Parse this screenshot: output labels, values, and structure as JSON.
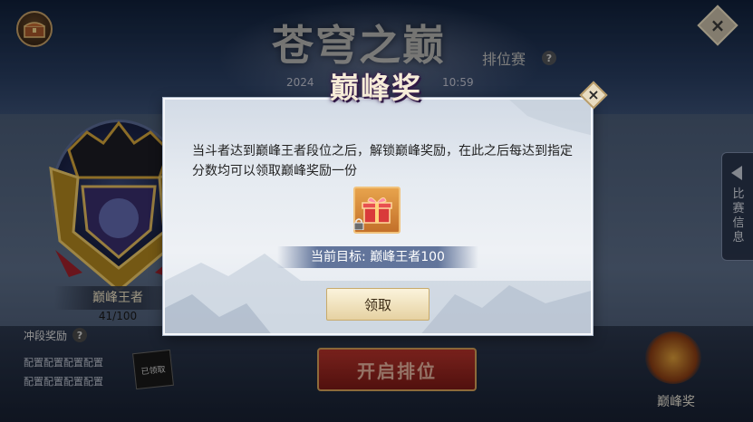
{
  "background": {
    "title": "苍穹之巅",
    "subtitle": "排位赛",
    "help_glyph": "?",
    "date_start": "2024",
    "date_end": "10:59",
    "close_glyph": "×",
    "chest_icon": "treasure-chest-icon"
  },
  "rank": {
    "name": "巅峰王者",
    "progress": "41/100",
    "rush_label": "冲段奖励",
    "rush_help": "?",
    "config_lines": [
      "配置配置配置配置",
      "配置配置配置配置"
    ],
    "claimed_stamp": "已领取"
  },
  "actions": {
    "start_label": "开启排位"
  },
  "side_tab": {
    "label": "比赛信息"
  },
  "peak_reward": {
    "label": "巅峰奖"
  },
  "modal": {
    "title": "巅峰奖",
    "close_glyph": "×",
    "description": "当斗者达到巅峰王者段位之后，解锁巅峰奖励，在此之后每达到指定分数均可以领取巅峰奖励一份",
    "target_text": "当前目标: 巅峰王者100",
    "claim_label": "领取",
    "reward_icon": "gift-box-icon"
  },
  "colors": {
    "modal_bg": "#e6ebf1",
    "start_button": "#b9342c",
    "claim_button": "#f3e6c2",
    "target_bar": "#5a6e96"
  }
}
